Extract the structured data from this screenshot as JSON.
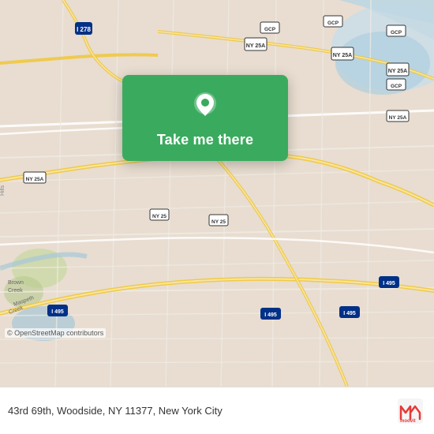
{
  "map": {
    "background_color": "#e8e0d8",
    "pin_color": "#3aab5e",
    "card_color": "#3aab5e"
  },
  "card": {
    "button_label": "Take me there"
  },
  "bottom_bar": {
    "address": "43rd 69th, Woodside, NY 11377, New York City",
    "copyright": "© OpenStreetMap contributors"
  },
  "moovit": {
    "logo_text": "moovit"
  }
}
